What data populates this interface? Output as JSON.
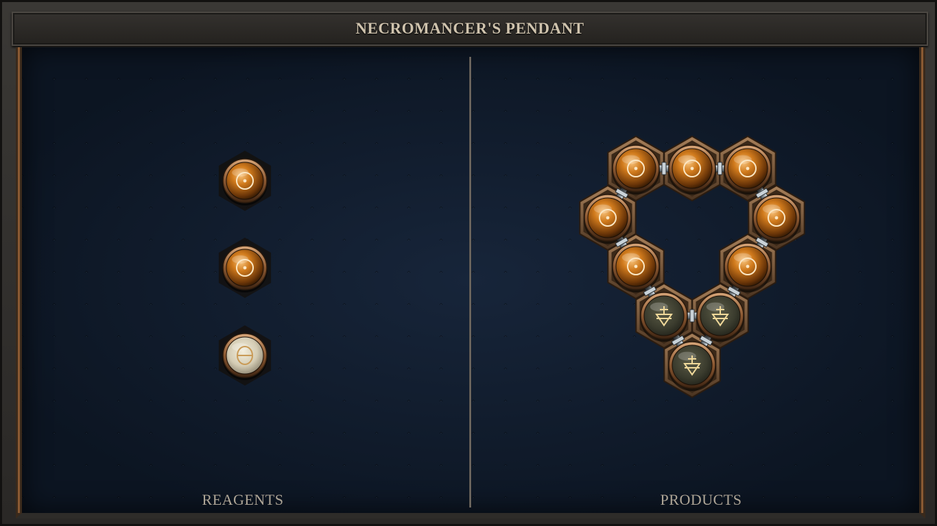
{
  "title": "NECROMANCER'S PENDANT",
  "reagents": {
    "label": "REAGENTS",
    "items": [
      {
        "name": "salt-atom",
        "kind": "salt",
        "color": "#d07a1c"
      },
      {
        "name": "salt-atom",
        "kind": "salt",
        "color": "#d07a1c"
      },
      {
        "name": "mors-atom",
        "kind": "mors",
        "color": "#d9d2bd"
      }
    ]
  },
  "products": {
    "label": "PRODUCTS",
    "salt_atoms": 7,
    "earth_atoms": 3
  },
  "colors": {
    "board": "#0f1a29",
    "copper": "#b4713a",
    "salt": "#d07a1c",
    "earth": "#4a4a38",
    "bond": "#9aa3aa",
    "frame": "#2f2d2a"
  }
}
